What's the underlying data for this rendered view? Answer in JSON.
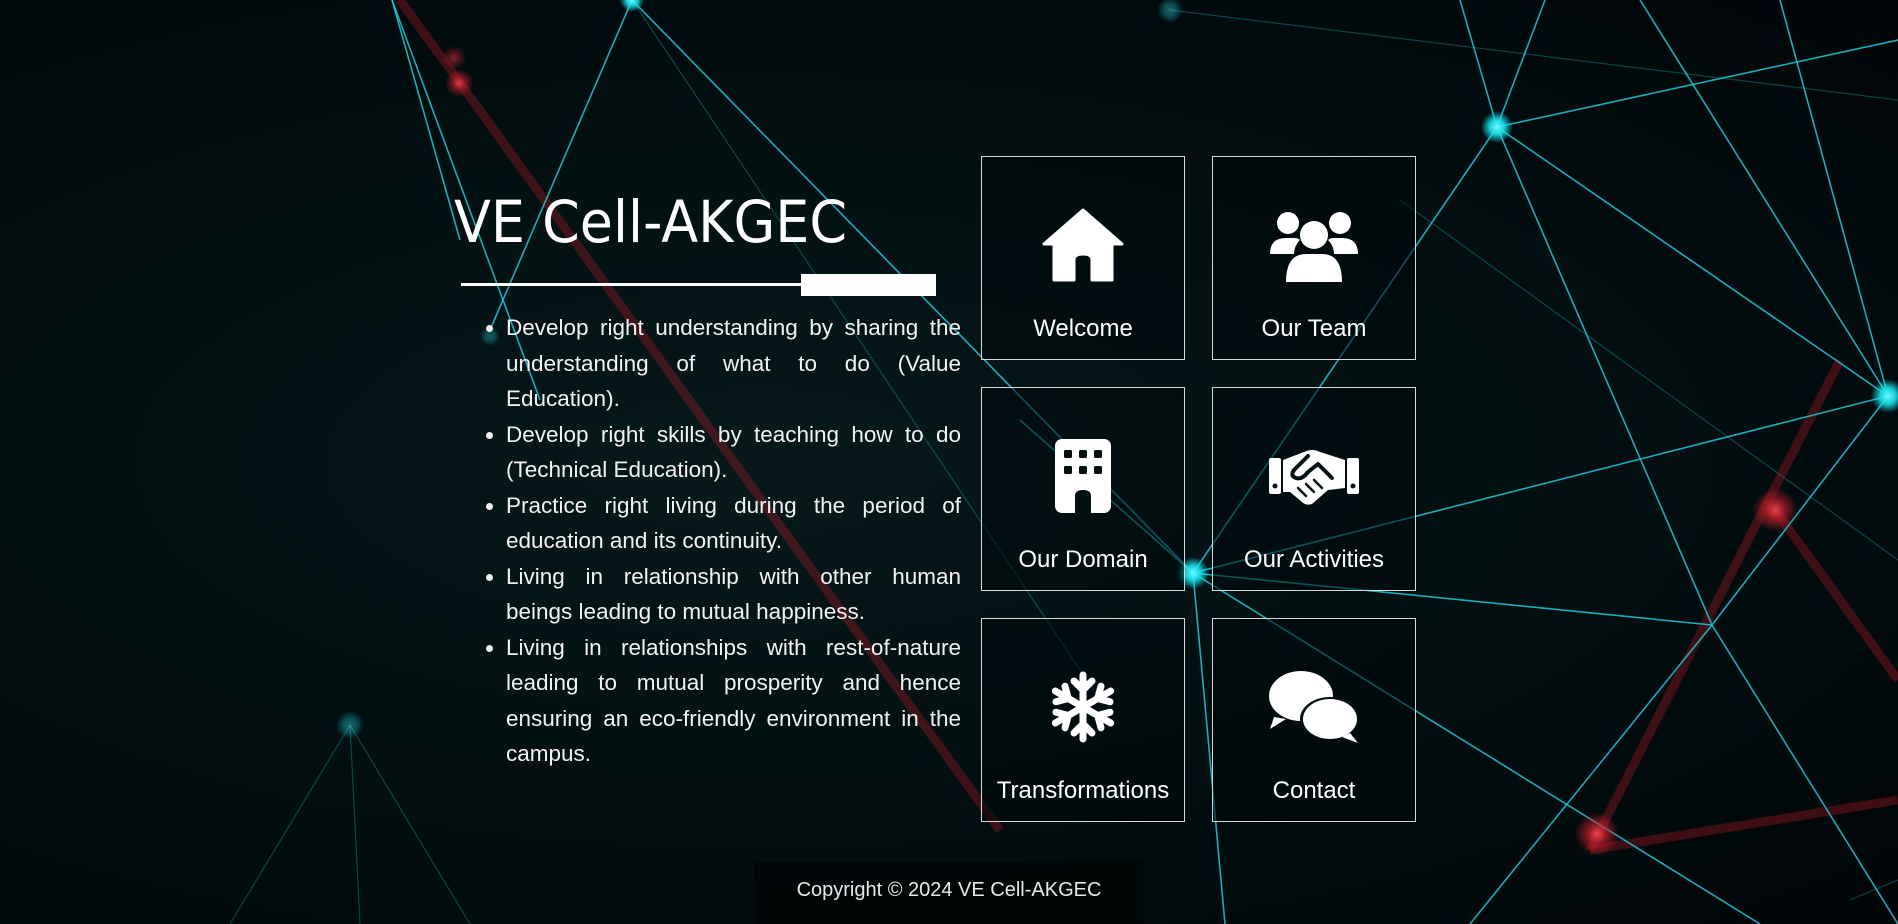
{
  "site": {
    "title": "VE Cell-AKGEC"
  },
  "intro": {
    "points": [
      "Develop right understanding by sharing the understanding of what to do (Value Education).",
      "Develop right skills by teaching how to do (Technical Education).",
      "Practice right living during the period of education and its continuity.",
      "Living in relationship with other human beings leading to mutual happiness.",
      "Living in relationships with rest-of-nature leading to mutual prosperity and hence ensuring an eco-friendly environment in the campus."
    ]
  },
  "tiles": [
    {
      "label": "Welcome",
      "icon": "home-icon"
    },
    {
      "label": "Our Team",
      "icon": "users-icon"
    },
    {
      "label": "Our Domain",
      "icon": "building-icon"
    },
    {
      "label": "Our Activities",
      "icon": "handshake-icon"
    },
    {
      "label": "Transformations",
      "icon": "snowflake-icon"
    },
    {
      "label": "Contact",
      "icon": "chat-bubbles-icon"
    }
  ],
  "footer": {
    "copyright": "Copyright © 2024 VE Cell-AKGEC"
  },
  "colors": {
    "network_line": "#1fc9d8",
    "network_node": "#19e6f0",
    "accent_red": "#e0202e",
    "background": "#020c0e",
    "text": "#ffffff"
  }
}
